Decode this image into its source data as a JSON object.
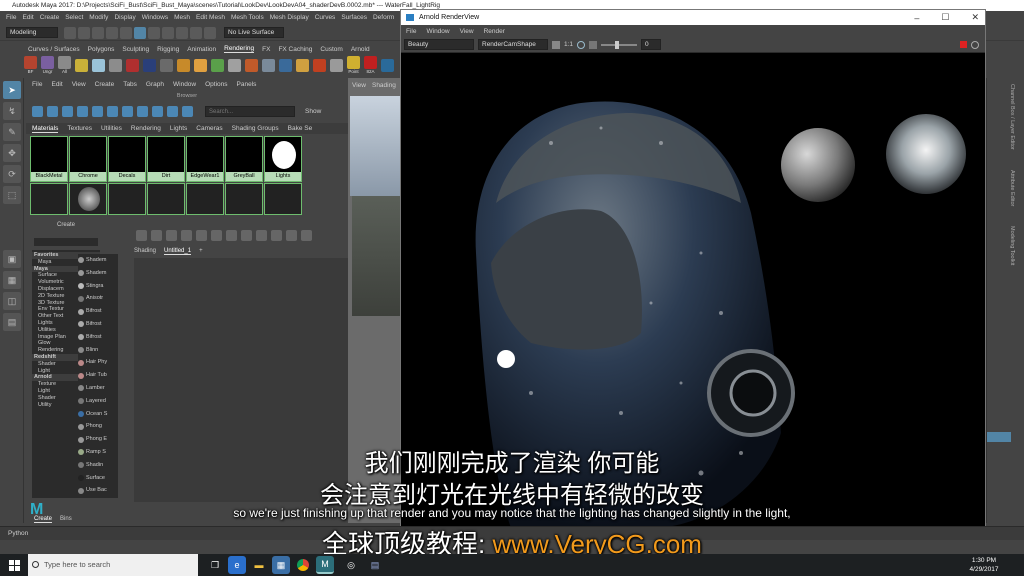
{
  "maya": {
    "title": "Autodesk Maya 2017: D:\\Projects\\SciFi_Bust\\SciFi_Bust_Maya\\scenes\\Tutorial\\LookDev\\LookDevA04_shaderDevB.0002.mb*    ---    WaterFall_LightRig",
    "menu": [
      "File",
      "Edit",
      "Create",
      "Select",
      "Modify",
      "Display",
      "Windows",
      "Mesh",
      "Edit Mesh",
      "Mesh Tools",
      "Mesh Display",
      "Curves",
      "Surfaces",
      "Deform"
    ],
    "mode": "Modeling",
    "live_surface": "No Live Surface",
    "shelf_tabs": [
      "Curves / Surfaces",
      "Polygons",
      "Sculpting",
      "Rigging",
      "Animation",
      "Rendering",
      "FX",
      "FX Caching",
      "Custom",
      "Arnold"
    ],
    "shelf_labels": [
      "BF",
      "Ungr",
      "All",
      "",
      "",
      "",
      "",
      "",
      "",
      "",
      "",
      "",
      "",
      "",
      "",
      "",
      "",
      "",
      "",
      "Point",
      "82A",
      ""
    ],
    "toolbox_icons": [
      "select-arrow-icon",
      "lasso-icon",
      "paint-icon",
      "move-icon",
      "rotate-icon",
      "scale-icon",
      "",
      "layout-single-icon",
      "layout-four-icon",
      "layout-two-icon",
      "layout-other-icon"
    ]
  },
  "hypershade": {
    "menu": [
      "File",
      "Edit",
      "View",
      "Create",
      "Tabs",
      "Graph",
      "Window",
      "Options",
      "Panels"
    ],
    "browser_label": "Browser",
    "search_placeholder": "Search...",
    "show_label": "Show",
    "tabs": [
      "Materials",
      "Textures",
      "Utilities",
      "Rendering",
      "Lights",
      "Cameras",
      "Shading Groups",
      "Bake Se"
    ],
    "materials": [
      "BlackMetal",
      "Chrome",
      "Decals",
      "Dirt",
      "EdgeWear1",
      "GreyBall",
      "Lights"
    ],
    "create_label": "Create",
    "tree": [
      {
        "label": "Favorites",
        "header": true
      },
      {
        "label": "Maya",
        "header": false
      },
      {
        "label": "Maya",
        "header": true
      },
      {
        "label": "Surface",
        "header": false
      },
      {
        "label": "Volumetric",
        "header": false
      },
      {
        "label": "Displacem",
        "header": false
      },
      {
        "label": "2D Texture",
        "header": false
      },
      {
        "label": "3D Texture",
        "header": false
      },
      {
        "label": "Env Textur",
        "header": false
      },
      {
        "label": "Other Text",
        "header": false
      },
      {
        "label": "Lights",
        "header": false
      },
      {
        "label": "Utilities",
        "header": false
      },
      {
        "label": "Image Plan",
        "header": false
      },
      {
        "label": "Glow",
        "header": false
      },
      {
        "label": "Rendering",
        "header": false
      },
      {
        "label": "Redshift",
        "header": true
      },
      {
        "label": "Shader",
        "header": false
      },
      {
        "label": "Light",
        "header": false
      },
      {
        "label": "Arnold",
        "header": true
      },
      {
        "label": "Texture",
        "header": false
      },
      {
        "label": "Light",
        "header": false
      },
      {
        "label": "Shader",
        "header": false
      },
      {
        "label": "Utility",
        "header": false
      }
    ],
    "nodes": [
      "Shadem",
      "Shadem",
      "Stingra",
      "Anisotr",
      "Bifrost",
      "Bifrost",
      "Bifrost",
      "Blinn",
      "Hair Phy",
      "Hair Tub",
      "Lamber",
      "Layered",
      "Ocean S",
      "Phong",
      "Phong E",
      "Ramp S",
      "Shadin",
      "Surface",
      "Use Bac"
    ],
    "work_tabs": [
      "Shading",
      "Untitled_1",
      "+"
    ],
    "bottom_tabs": [
      "Create",
      "Bins"
    ]
  },
  "viewport": {
    "menu": [
      "View",
      "Shading"
    ]
  },
  "right_panel": {
    "tabs": [
      "Channel Box / Layer Editor",
      "Attribute Editor",
      "Modeling Toolkit"
    ]
  },
  "arnold": {
    "title": "Arnold RenderView",
    "menu": [
      "File",
      "Window",
      "View",
      "Render"
    ],
    "aov": "Beauty",
    "camera": "RenderCamShape",
    "zoom": "1:1",
    "exposure": "0"
  },
  "subtitles": {
    "cn1": "我们刚刚完成了渲染 你可能",
    "cn2": "会注意到灯光在光线中有轻微的改变",
    "en": "so we're just finishing up that render and you may notice that the lighting has changed slightly in the light,",
    "brand_cn": "全球顶级教程:",
    "brand_url": "www.VeryCG.com"
  },
  "python_label": "Python",
  "taskbar": {
    "search_placeholder": "Type here to search",
    "time": "1:30 PM",
    "date": "4/29/2017"
  },
  "colors": {
    "accent": "#5285a6",
    "material_label_bg": "#b7dcb7",
    "brand_orange": "#f29a1c"
  }
}
